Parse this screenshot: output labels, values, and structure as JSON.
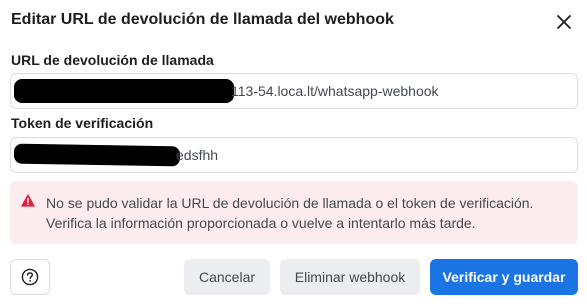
{
  "dialog": {
    "title": "Editar URL de devolución de llamada del webhook",
    "close_icon": "close-icon"
  },
  "callback_url": {
    "label": "URL de devolución de llamada",
    "visible_value": "113-54.loca.lt/whatsapp-webhook",
    "redacted": true
  },
  "verify_token": {
    "label": "Token de verificación",
    "visible_value": "edsfhh",
    "redacted": true
  },
  "error": {
    "icon": "warning-icon",
    "message": "No se pudo validar la URL de devolución de llamada o el token de verificación. Verifica la información proporcionada o vuelve a intentarlo más tarde."
  },
  "footer": {
    "help_icon": "help-icon",
    "cancel_label": "Cancelar",
    "delete_label": "Eliminar webhook",
    "save_label": "Verificar y guardar"
  },
  "colors": {
    "primary": "#1b74e4",
    "error_background": "#fdeced",
    "error_icon": "#e41e3f",
    "secondary_button": "#ebedf0",
    "border": "#dadde1"
  }
}
